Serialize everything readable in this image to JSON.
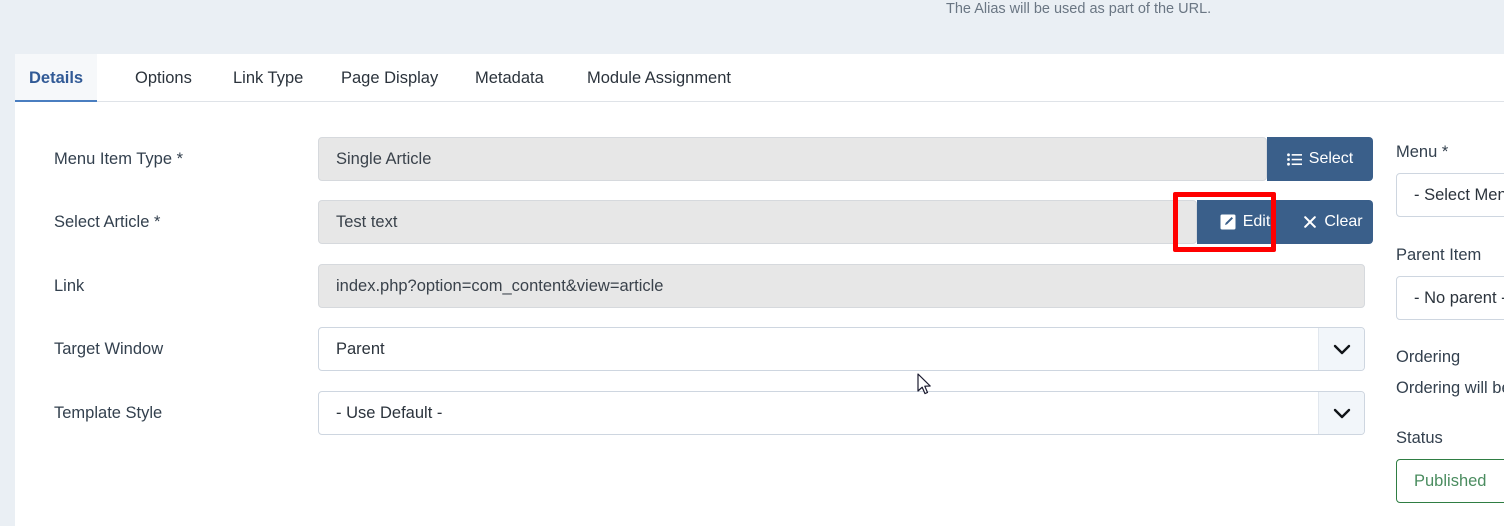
{
  "header": {
    "alias_help": "The Alias will be used as part of the URL."
  },
  "tabs": [
    {
      "label": "Details",
      "active": true
    },
    {
      "label": "Options",
      "active": false
    },
    {
      "label": "Link Type",
      "active": false
    },
    {
      "label": "Page Display",
      "active": false
    },
    {
      "label": "Metadata",
      "active": false
    },
    {
      "label": "Module Assignment",
      "active": false
    }
  ],
  "form": {
    "menu_item_type": {
      "label": "Menu Item Type *",
      "value": "Single Article",
      "button": {
        "label": "Select",
        "icon": "list-icon"
      }
    },
    "select_article": {
      "label": "Select Article *",
      "value": "Test text",
      "edit_button": {
        "label": "Edit",
        "icon": "pencil-square-icon"
      },
      "clear_button": {
        "label": "Clear",
        "icon": "close-x-icon"
      }
    },
    "link": {
      "label": "Link",
      "value": "index.php?option=com_content&view=article"
    },
    "target_window": {
      "label": "Target Window",
      "value": "Parent"
    },
    "template_style": {
      "label": "Template Style",
      "value": "- Use Default -"
    }
  },
  "sidebar": {
    "menu": {
      "label": "Menu *",
      "value": "- Select Menu -"
    },
    "parent_item": {
      "label": "Parent Item",
      "value": "- No parent -"
    },
    "ordering": {
      "label": "Ordering",
      "note": "Ordering will be available after saving."
    },
    "status": {
      "label": "Status",
      "value": "Published"
    }
  },
  "colors": {
    "accent": "#4a7ec0",
    "button": "#3a5f8a",
    "highlight": "#ff0000",
    "status_green": "#2f7d43",
    "strip": "#eaeff4"
  }
}
